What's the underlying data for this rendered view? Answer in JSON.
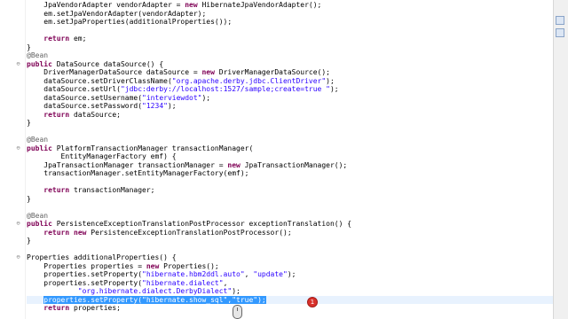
{
  "editor": {
    "lines": [
      [
        [
          "",
          "    JpaVendorAdapter vendorAdapter = "
        ],
        [
          "kw",
          "new"
        ],
        [
          "",
          " HibernateJpaVendorAdapter();"
        ]
      ],
      [
        [
          "",
          "    em.setJpaVendorAdapter(vendorAdapter);"
        ]
      ],
      [
        [
          "",
          "    em.setJpaProperties(additionalProperties());"
        ]
      ],
      [
        [
          "",
          ""
        ]
      ],
      [
        [
          "",
          "    "
        ],
        [
          "kw",
          "return"
        ],
        [
          "",
          " em;"
        ]
      ],
      [
        [
          "",
          "}"
        ]
      ],
      [
        [
          "ann",
          "@Bean"
        ]
      ],
      [
        [
          "kw",
          "public"
        ],
        [
          "",
          " DataSource dataSource() {"
        ]
      ],
      [
        [
          "",
          "    DriverManagerDataSource dataSource = "
        ],
        [
          "kw",
          "new"
        ],
        [
          "",
          " DriverManagerDataSource();"
        ]
      ],
      [
        [
          "",
          "    dataSource.setDriverClassName("
        ],
        [
          "str",
          "\"org.apache.derby.jdbc.ClientDriver\""
        ],
        [
          "",
          ");"
        ]
      ],
      [
        [
          "",
          "    dataSource.setUrl("
        ],
        [
          "str",
          "\"jdbc:derby://localhost:1527/sample;create=true \""
        ],
        [
          "",
          ");"
        ]
      ],
      [
        [
          "",
          "    dataSource.setUsername("
        ],
        [
          "str",
          "\"interviewdot\""
        ],
        [
          "",
          ");"
        ]
      ],
      [
        [
          "",
          "    dataSource.setPassword("
        ],
        [
          "str",
          "\"1234\""
        ],
        [
          "",
          ");"
        ]
      ],
      [
        [
          "",
          "    "
        ],
        [
          "kw",
          "return"
        ],
        [
          "",
          " dataSource;"
        ]
      ],
      [
        [
          "",
          "}"
        ]
      ],
      [
        [
          "",
          ""
        ]
      ],
      [
        [
          "ann",
          "@Bean"
        ]
      ],
      [
        [
          "kw",
          "public"
        ],
        [
          "",
          " PlatformTransactionManager transactionManager("
        ]
      ],
      [
        [
          "",
          "        EntityManagerFactory emf) {"
        ]
      ],
      [
        [
          "",
          "    JpaTransactionManager transactionManager = "
        ],
        [
          "kw",
          "new"
        ],
        [
          "",
          " JpaTransactionManager();"
        ]
      ],
      [
        [
          "",
          "    transactionManager.setEntityManagerFactory(emf);"
        ]
      ],
      [
        [
          "",
          ""
        ]
      ],
      [
        [
          "",
          "    "
        ],
        [
          "kw",
          "return"
        ],
        [
          "",
          " transactionManager;"
        ]
      ],
      [
        [
          "",
          "}"
        ]
      ],
      [
        [
          "",
          ""
        ]
      ],
      [
        [
          "ann",
          "@Bean"
        ]
      ],
      [
        [
          "kw",
          "public"
        ],
        [
          "",
          " PersistenceExceptionTranslationPostProcessor exceptionTranslation() {"
        ]
      ],
      [
        [
          "",
          "    "
        ],
        [
          "kw",
          "return"
        ],
        [
          "",
          " "
        ],
        [
          "kw",
          "new"
        ],
        [
          "",
          " PersistenceExceptionTranslationPostProcessor();"
        ]
      ],
      [
        [
          "",
          "}"
        ]
      ],
      [
        [
          "",
          ""
        ]
      ],
      [
        [
          "",
          "Properties additionalProperties() {"
        ]
      ],
      [
        [
          "",
          "    Properties properties = "
        ],
        [
          "kw",
          "new"
        ],
        [
          "",
          " Properties();"
        ]
      ],
      [
        [
          "",
          "    properties.setProperty("
        ],
        [
          "str",
          "\"hibernate.hbm2ddl.auto\""
        ],
        [
          "",
          ", "
        ],
        [
          "str",
          "\"update\""
        ],
        [
          "",
          ");"
        ]
      ],
      [
        [
          "",
          "    properties.setProperty("
        ],
        [
          "str",
          "\"hibernate.dialect\""
        ],
        [
          "",
          ","
        ]
      ],
      [
        [
          "",
          "            "
        ],
        [
          "str",
          "\"org.hibernate.dialect.DerbyDialect\""
        ],
        [
          "",
          ");"
        ]
      ],
      [
        [
          "",
          "    "
        ],
        [
          "sel",
          "properties.setProperty(\"hibernate.show_sql\",\"true\");"
        ]
      ],
      [
        [
          "",
          "    "
        ],
        [
          "kw",
          "return"
        ],
        [
          "",
          " properties;"
        ]
      ]
    ],
    "highlighted_line": 35,
    "fold_lines": [
      7,
      17,
      26,
      30
    ],
    "error_marker": "1"
  }
}
